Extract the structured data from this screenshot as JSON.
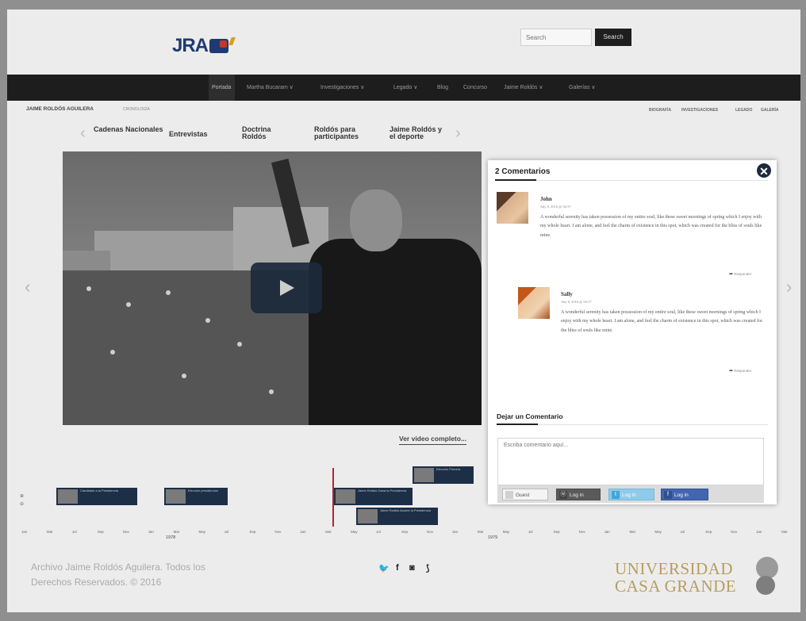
{
  "header": {
    "logo_text": "JRA",
    "search_placeholder": "Search",
    "search_button": "Search"
  },
  "nav": {
    "items": [
      "Portada",
      "Martha Bucaram ∨",
      "Investigaciones ∨",
      "Legado ∨",
      "Blog",
      "Concurso",
      "Jaime Roldós ∨",
      "Galerías ∨"
    ]
  },
  "breadcrumb": {
    "title": "JAIME ROLDÓS AGUILERA",
    "subtitle": "CRONOLOGÍA",
    "right_links": [
      "BIOGRAFÍA",
      "INVESTIGACIONES",
      "LEGADO",
      "GALERÍA"
    ]
  },
  "categories": [
    "Cadenas Nacionales",
    "Entrevistas",
    "Doctrina Roldós",
    "Roldós para participantes",
    "Jaime Roldós y el deporte"
  ],
  "video": {
    "link_text": "Ver video completo..."
  },
  "timeline": {
    "cards": [
      {
        "text": "Candidato a la Presidencia"
      },
      {
        "text": "Elección presidencial"
      },
      {
        "text": "Jaime Roldós Gana la Presidencia"
      },
      {
        "text": "Jaime Roldós Asume la Presidencia"
      },
      {
        "text": "Elección Primera"
      }
    ],
    "months": [
      "Jan",
      "Mar",
      "Jul",
      "Sep",
      "Nov",
      "Jan",
      "Mar",
      "May",
      "Jul",
      "Sep",
      "Nov",
      "Jan",
      "Mar",
      "May",
      "Jul",
      "Sep",
      "Nov",
      "Jan",
      "Mar",
      "May",
      "Jul",
      "Sep",
      "Nov",
      "Jan",
      "Mar",
      "May",
      "Jul",
      "Sep",
      "Nov",
      "Jan",
      "Mar"
    ],
    "years": [
      "1978",
      "1979"
    ]
  },
  "footer": {
    "copyright_line1": "Archivo Jaime Roldós Aguilera. Todos los",
    "copyright_line2": "Derechos Reservados. © 2016",
    "university_line1": "UNIVERSIDAD",
    "university_line2": "CASA GRANDE"
  },
  "modal": {
    "title": "2 Comentarios",
    "comments": [
      {
        "name": "John",
        "date": "July 8, 2016 @ 04:37",
        "body": "A wonderful serenity has taken possession of my entire soul, like these sweet mornings of spring which I enjoy with my whole heart. I am alone, and feel the charm of existence in this spot, which was created for the bliss of souls like mine.",
        "reply": "Responder"
      },
      {
        "name": "Sally",
        "date": "July 8, 2016 @ 04:37",
        "body": "A wonderful serenity has taken possession of my entire soul, like these sweet mornings of spring which I enjoy with my whole heart. I am alone, and feel the charm of existence in this spot, which was created for the bliss of souls like mine.",
        "reply": "Responder"
      }
    ],
    "leave_title": "Dejar un Comentario",
    "comment_placeholder": "Escriba comentario aquí...",
    "login_buttons": [
      "Guest",
      "Log in",
      "Log in",
      "Log in"
    ]
  }
}
